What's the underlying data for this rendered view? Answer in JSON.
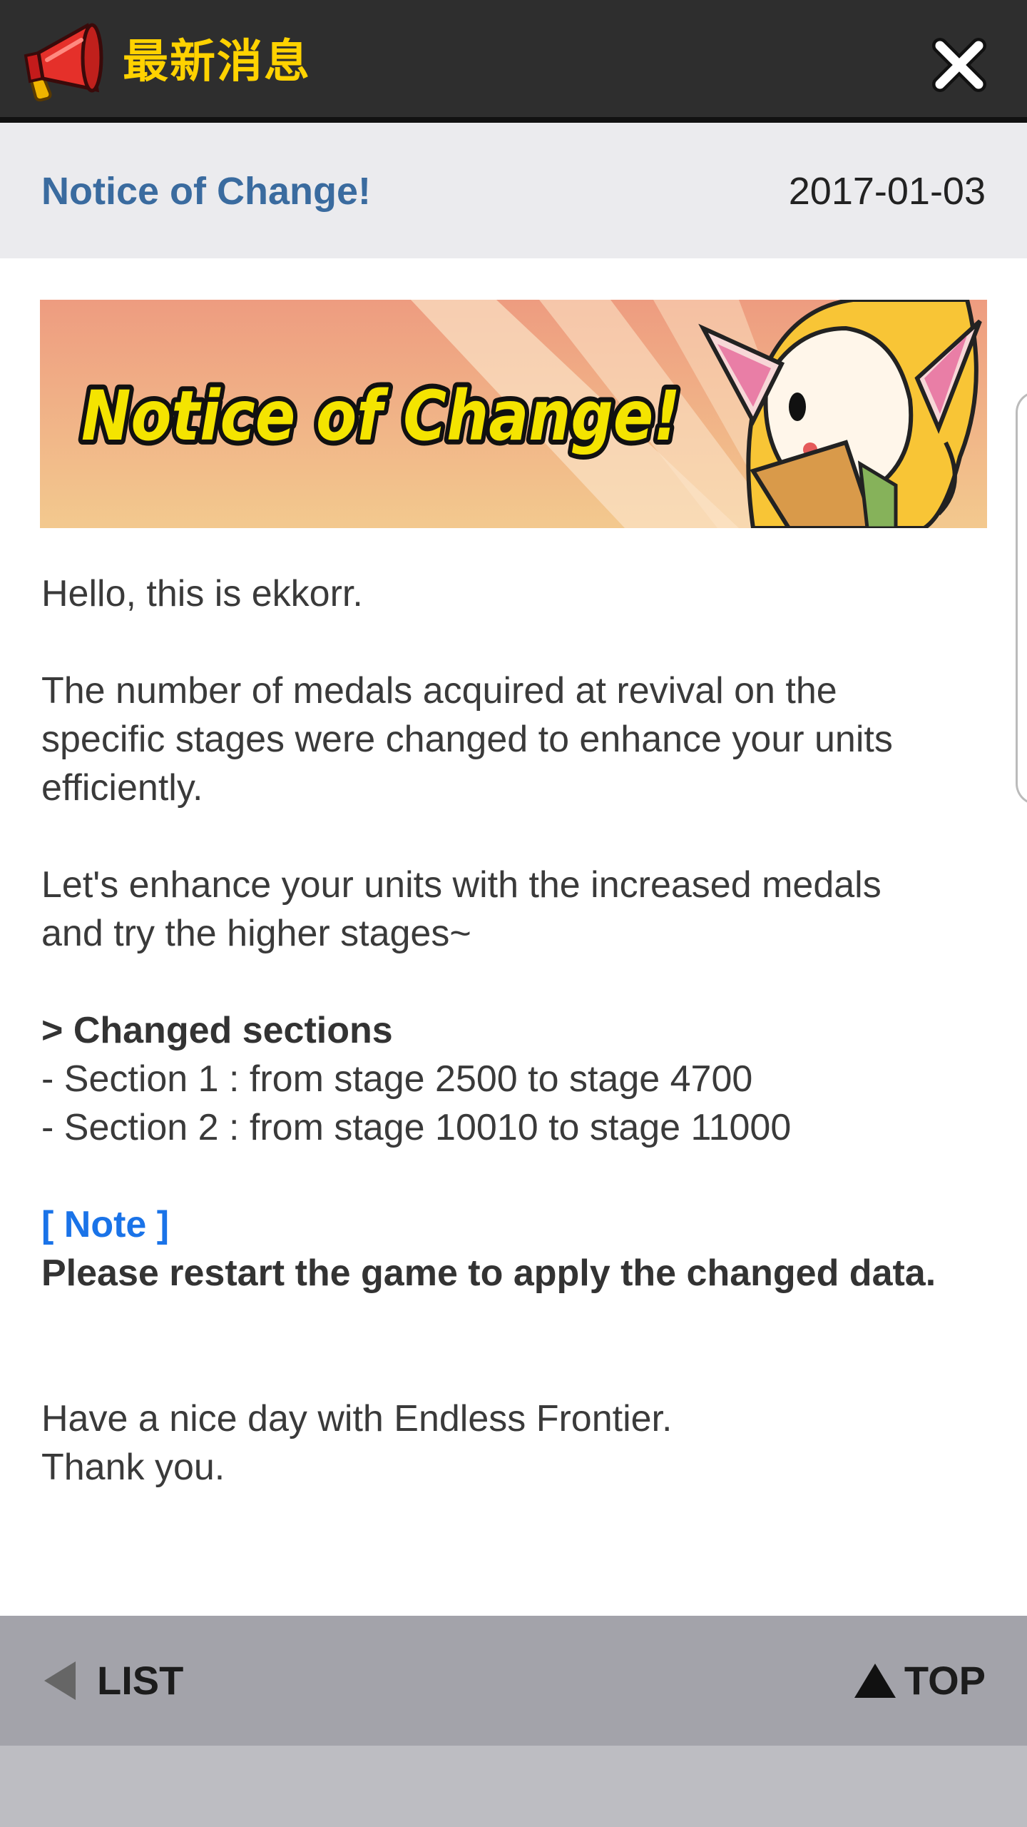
{
  "header": {
    "title": "最新消息",
    "close_icon": "close-icon",
    "megaphone_icon": "megaphone-icon",
    "title_color": "#ffd200"
  },
  "notice": {
    "title": "Notice of Change!",
    "date": "2017-01-03",
    "title_color": "#3a6b9f"
  },
  "banner": {
    "text": "Notice of Change!"
  },
  "body": {
    "greeting": "Hello, this is ekkorr.",
    "paragraph1_line1": "The number of medals acquired at revival on the",
    "paragraph1_line2": "specific stages were changed to enhance your units",
    "paragraph1_line3": "efficiently.",
    "paragraph2_line1": "Let's enhance your units with the increased medals",
    "paragraph2_line2": "and try the higher stages~",
    "sections_heading": "> Changed sections",
    "section1": "- Section 1 : from stage 2500 to stage 4700",
    "section2": "- Section 2 : from stage 10010 to stage 11000",
    "note_label": "[ Note ]",
    "note_text": "Please restart the game to apply the changed data.",
    "closing_line1": "Have a nice day with Endless Frontier.",
    "closing_line2": "Thank you.",
    "note_color": "#1a73e8"
  },
  "footer": {
    "list_label": "LIST",
    "top_label": "TOP",
    "list_icon": "triangle-left-icon",
    "top_icon": "triangle-up-icon"
  }
}
